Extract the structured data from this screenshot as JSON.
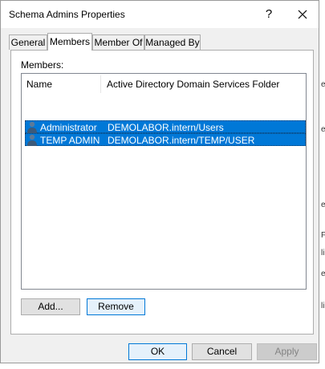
{
  "window": {
    "title": "Schema Admins Properties",
    "help_label": "?"
  },
  "tabs": [
    {
      "label": "General",
      "active": false
    },
    {
      "label": "Members",
      "active": true
    },
    {
      "label": "Member Of",
      "active": false
    },
    {
      "label": "Managed By",
      "active": false
    }
  ],
  "members": {
    "label": "Members:",
    "columns": [
      "Name",
      "Active Directory Domain Services Folder"
    ],
    "rows": [
      {
        "name": "Administrator",
        "folder": "DEMOLABOR.intern/Users",
        "selected": true
      },
      {
        "name": "TEMP ADMIN",
        "folder": "DEMOLABOR.intern/TEMP/USER",
        "selected": true
      }
    ],
    "add_label": "Add...",
    "remove_label": "Remove"
  },
  "footer": {
    "ok_label": "OK",
    "cancel_label": "Cancel",
    "apply_label": "Apply"
  },
  "colors": {
    "selection": "#0078d7",
    "dialog_bg": "#f0f0f0"
  }
}
